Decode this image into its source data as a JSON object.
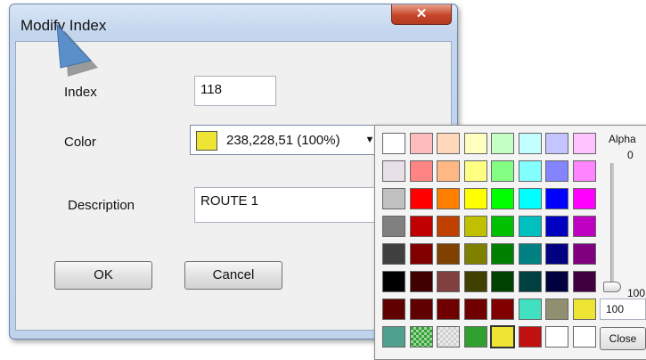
{
  "dialog": {
    "title": "Modify Index",
    "close_glyph": "✕",
    "index_label": "Index",
    "index_value": "118",
    "color_label": "Color",
    "color_value": "238,228,51 (100%)",
    "color_swatch": "#eee433",
    "description_label": "Description",
    "description_value": "ROUTE 1",
    "ok_label": "OK",
    "cancel_label": "Cancel"
  },
  "picker": {
    "alpha_label": "Alpha",
    "alpha_max_label": "0",
    "alpha_min_label": "100",
    "alpha_value": "100",
    "close_label": "Close",
    "rows": [
      [
        "#ffffff",
        "#ffbcbc",
        "#ffd8bc",
        "#ffffc0",
        "#c4ffc4",
        "#c4ffff",
        "#c4c4ff",
        "#ffc4ff"
      ],
      [
        "#e8e0e8",
        "#ff8484",
        "#ffb884",
        "#ffff84",
        "#84ff84",
        "#84ffff",
        "#8484ff",
        "#ff84ff"
      ],
      [
        "#c0c0c0",
        "#ff0000",
        "#ff8000",
        "#ffff00",
        "#00ff00",
        "#00ffff",
        "#0000ff",
        "#ff00ff"
      ],
      [
        "#808080",
        "#c00000",
        "#c04000",
        "#c0c000",
        "#00c000",
        "#00c0c0",
        "#0000c0",
        "#c000c0"
      ],
      [
        "#404040",
        "#800000",
        "#804000",
        "#808000",
        "#008000",
        "#008080",
        "#000080",
        "#800080"
      ],
      [
        "#000000",
        "#400000",
        "#804040",
        "#404000",
        "#004000",
        "#004040",
        "#000040",
        "#400040"
      ],
      [
        "#600000",
        "#600000",
        "#700000",
        "#700000",
        "#800000",
        "#40e0c0",
        "#909070",
        "#eee433"
      ],
      [
        "#50a090",
        "#30a030",
        "#d0d0d0",
        "#30a030",
        "#eee433",
        "#c01010",
        "#ffffff",
        "#ffffff"
      ]
    ]
  }
}
